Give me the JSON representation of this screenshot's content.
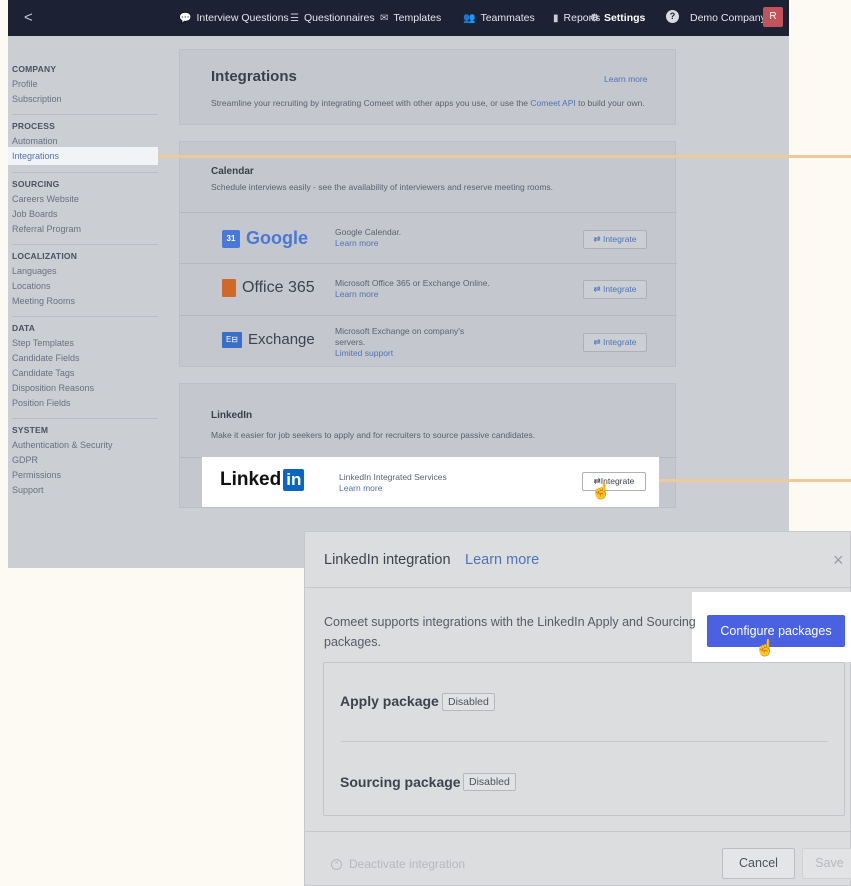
{
  "topnav": {
    "back": "<",
    "items": [
      {
        "label": "Interview Questions",
        "icon": "chat-icon"
      },
      {
        "label": "Questionnaires",
        "icon": "list-icon"
      },
      {
        "label": "Templates",
        "icon": "mail-icon"
      },
      {
        "label": "Teammates",
        "icon": "people-icon"
      },
      {
        "label": "Reports",
        "icon": "bar-chart-icon"
      },
      {
        "label": "Settings",
        "icon": "gear-icon"
      }
    ],
    "help": "?",
    "company": "Demo Company",
    "avatar": "R"
  },
  "sidebar": {
    "groups": [
      {
        "heading": "COMPANY",
        "items": [
          "Profile",
          "Subscription"
        ]
      },
      {
        "heading": "PROCESS",
        "items": [
          "Automation",
          "Integrations"
        ]
      },
      {
        "heading": "SOURCING",
        "items": [
          "Careers Website",
          "Job Boards",
          "Referral Program"
        ]
      },
      {
        "heading": "LOCALIZATION",
        "items": [
          "Languages",
          "Locations",
          "Meeting Rooms"
        ]
      },
      {
        "heading": "DATA",
        "items": [
          "Step Templates",
          "Candidate Fields",
          "Candidate Tags",
          "Disposition Reasons",
          "Position Fields"
        ]
      },
      {
        "heading": "SYSTEM",
        "items": [
          "Authentication & Security",
          "GDPR",
          "Permissions",
          "Support"
        ]
      }
    ]
  },
  "integrations": {
    "title": "Integrations",
    "learn_more": "Learn more",
    "desc_prefix": "Streamline your recruiting by integrating Comeet with other apps you use, or use the ",
    "api_link": "Comeet API",
    "desc_suffix": " to build your own."
  },
  "calendar": {
    "title": "Calendar",
    "desc": "Schedule interviews easily - see the availability of interviewers and reserve meeting rooms.",
    "rows": [
      {
        "logo": "Google",
        "line1": "Google Calendar.",
        "line2": "",
        "link": "Learn more",
        "button": "⇄ Integrate"
      },
      {
        "logo": "Office 365",
        "line1": "Microsoft Office 365 or Exchange Online.",
        "line2": "",
        "link": "Learn more",
        "button": "⇄ Integrate"
      },
      {
        "logo": "Exchange",
        "line1": "Microsoft Exchange on company's",
        "line2": "servers.",
        "link": "Limited support",
        "button": "⇄ Integrate"
      }
    ]
  },
  "linkedin": {
    "title": "LinkedIn",
    "desc": "Make it easier for job seekers to apply and for recruiters to source passive candidates.",
    "logo_text": "Linked",
    "logo_badge": "in",
    "service": "LinkedIn Integrated Services",
    "link": "Learn more",
    "button": "⇄Integrate"
  },
  "modal": {
    "title": "LinkedIn integration",
    "learn_more": "Learn more",
    "close": "×",
    "desc": "Comeet supports integrations with the LinkedIn Apply and Sourcing packages.",
    "configure": "Configure packages",
    "apply_label": "Apply package",
    "apply_status": "Disabled",
    "sourcing_label": "Sourcing package",
    "sourcing_status": "Disabled",
    "deactivate": "Deactivate integration",
    "cancel": "Cancel",
    "save": "Save"
  },
  "colors": {
    "nav_bg": "#1c2133",
    "accent": "#4a62e2",
    "link": "#4f74b6",
    "highlight_line": "#f0c99a",
    "linkedin_blue": "#0a66c2"
  }
}
